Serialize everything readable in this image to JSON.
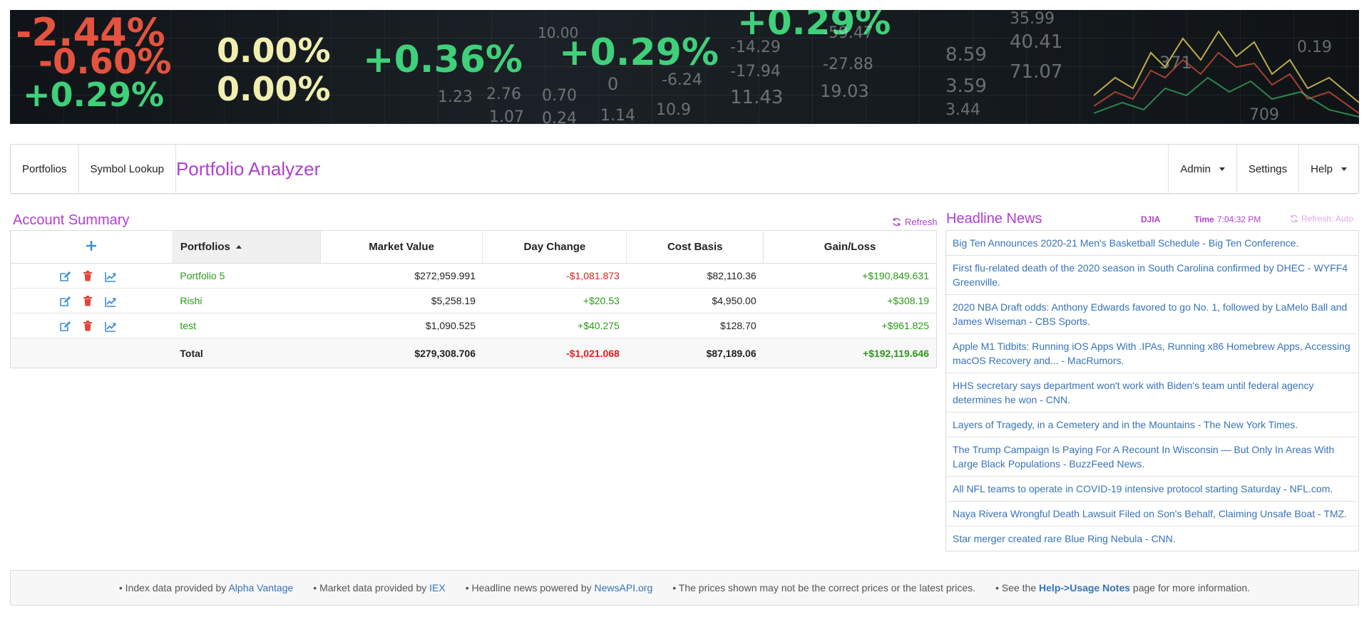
{
  "banner": {
    "alt": "stock-ticker-banner",
    "tickers": [
      {
        "text": "-2.44%",
        "tone": "red"
      },
      {
        "text": "-0.60%",
        "tone": "red"
      },
      {
        "text": "+0.29%",
        "tone": "green"
      },
      {
        "text": "0.00%",
        "tone": "yellow"
      },
      {
        "text": "0.00%",
        "tone": "yellow"
      },
      {
        "text": "+0.36%",
        "tone": "green"
      },
      {
        "text": "+0.29%",
        "tone": "green"
      },
      {
        "text": "+0.29%",
        "tone": "green"
      },
      {
        "text": "10.00",
        "tone": "gray"
      },
      {
        "text": "-14.29",
        "tone": "gray"
      },
      {
        "text": "-59.47",
        "tone": "gray"
      },
      {
        "text": "-17.94",
        "tone": "gray"
      },
      {
        "text": "-27.88",
        "tone": "gray"
      },
      {
        "text": "8.59",
        "tone": "gray"
      },
      {
        "text": "40.41",
        "tone": "gray"
      },
      {
        "text": "71.07",
        "tone": "gray"
      },
      {
        "text": "3.59",
        "tone": "gray"
      },
      {
        "text": "3.44",
        "tone": "gray"
      },
      {
        "text": "1.23",
        "tone": "gray"
      },
      {
        "text": "2.76",
        "tone": "gray"
      },
      {
        "text": "0.70",
        "tone": "gray"
      },
      {
        "text": "0",
        "tone": "gray"
      },
      {
        "text": "-6.24",
        "tone": "gray"
      },
      {
        "text": "11.43",
        "tone": "gray"
      },
      {
        "text": "19.03",
        "tone": "gray"
      },
      {
        "text": "0.24",
        "tone": "gray"
      },
      {
        "text": "1.14",
        "tone": "gray"
      },
      {
        "text": "10.9",
        "tone": "gray"
      },
      {
        "text": "709",
        "tone": "gray"
      },
      {
        "text": "0.19",
        "tone": "gray"
      },
      {
        "text": "35.99",
        "tone": "gray"
      },
      {
        "text": "1.07",
        "tone": "gray"
      },
      {
        "text": "371",
        "tone": "gray"
      }
    ]
  },
  "nav": {
    "portfolios": "Portfolios",
    "symbol_lookup": "Symbol Lookup",
    "brand": "Portfolio Analyzer",
    "admin": "Admin",
    "settings": "Settings",
    "help": "Help"
  },
  "summary": {
    "title": "Account Summary",
    "refresh": "Refresh",
    "columns": [
      "Portfolios",
      "Market Value",
      "Day Change",
      "Cost Basis",
      "Gain/Loss"
    ],
    "rows": [
      {
        "name": "Portfolio 5",
        "market_value": "$272,959.991",
        "day_change": "-$1,081.873",
        "day_change_sign": "neg",
        "cost_basis": "$82,110.36",
        "gain_loss": "+$190,849.631",
        "gain_loss_sign": "pos"
      },
      {
        "name": "Rishi",
        "market_value": "$5,258.19",
        "day_change": "+$20.53",
        "day_change_sign": "pos",
        "cost_basis": "$4,950.00",
        "gain_loss": "+$308.19",
        "gain_loss_sign": "pos"
      },
      {
        "name": "test",
        "market_value": "$1,090.525",
        "day_change": "+$40.275",
        "day_change_sign": "pos",
        "cost_basis": "$128.70",
        "gain_loss": "+$961.825",
        "gain_loss_sign": "pos"
      }
    ],
    "total": {
      "label": "Total",
      "market_value": "$279,308.706",
      "day_change": "-$1,021.068",
      "cost_basis": "$87,189.06",
      "gain_loss": "+$192,119.646"
    }
  },
  "news": {
    "title": "Headline News",
    "index_label": "DJIA",
    "time_label": "Time",
    "time_value": "7:04:32 PM",
    "refresh": "Refresh: Auto",
    "items": [
      "Big Ten Announces 2020-21 Men's Basketball Schedule - Big Ten Conference.",
      "First flu-related death of the 2020 season in South Carolina confirmed by DHEC - WYFF4 Greenville.",
      "2020 NBA Draft odds: Anthony Edwards favored to go No. 1, followed by LaMelo Ball and James Wiseman - CBS Sports.",
      "Apple M1 Tidbits: Running iOS Apps With .IPAs, Running x86 Homebrew Apps, Accessing macOS Recovery and... - MacRumors.",
      "HHS secretary says department won't work with Biden's team until federal agency determines he won - CNN.",
      "Layers of Tragedy, in a Cemetery and in the Mountains - The New York Times.",
      "The Trump Campaign Is Paying For A Recount In Wisconsin — But Only In Areas With Large Black Populations - BuzzFeed News.",
      "All NFL teams to operate in COVID-19 intensive protocol starting Saturday - NFL.com.",
      "Naya Rivera Wrongful Death Lawsuit Filed on Son's Behalf, Claiming Unsafe Boat - TMZ.",
      "Star merger created rare Blue Ring Nebula - CNN."
    ]
  },
  "footer": {
    "index_prefix": "• Index data provided by ",
    "index_link": "Alpha Vantage",
    "market_prefix": "• Market data provided by ",
    "market_link": "IEX",
    "news_prefix": "• Headline news powered by ",
    "news_link": "NewsAPI.org",
    "disclaimer": "• The prices shown may not be the correct prices or the latest prices.",
    "see_prefix": "• See the ",
    "see_link": "Help->Usage Notes",
    "see_suffix": " page for more information."
  },
  "colors": {
    "accent": "#b03fd0",
    "link": "#3673b9",
    "positive": "#2a9a18",
    "negative": "#e0201e"
  }
}
